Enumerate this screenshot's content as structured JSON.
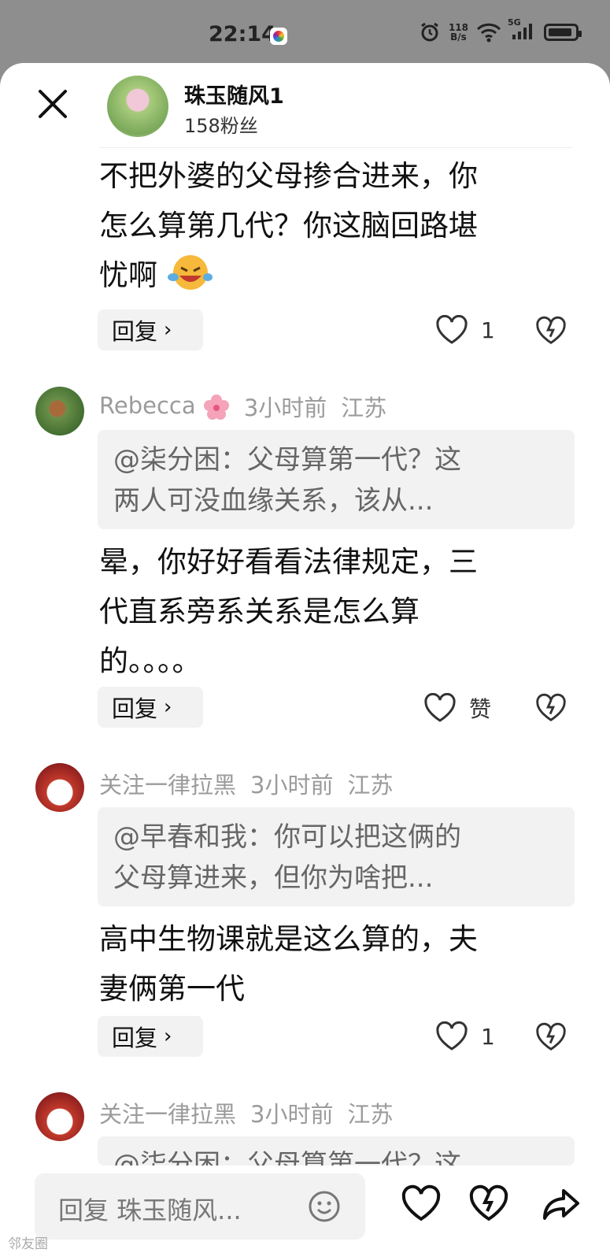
{
  "status_bar": {
    "time": "22:14",
    "net_speed_value": "118",
    "net_speed_unit": "B/s",
    "signal_label": "5G"
  },
  "header": {
    "author_name": "珠玉随风1",
    "fans": "158粉丝"
  },
  "main_comment": {
    "lines": [
      "不把外婆的父母掺合进来，你",
      "怎么算第几代？你这脑回路堪",
      "忧啊"
    ],
    "reply_label": "回复",
    "like_count": "1"
  },
  "comments": [
    {
      "user": "Rebecca",
      "time": "3小时前",
      "location": "江苏",
      "quote_lines": [
        "@柒分困：父母算第一代？这",
        "两人可没血缘关系，该从..."
      ],
      "text_lines": [
        "晕，你好好看看法律规定，三",
        "代直系旁系关系是怎么算",
        "的。。。。"
      ],
      "reply_label": "回复",
      "like_label": "赞"
    },
    {
      "user": "关注一律拉黑",
      "time": "3小时前",
      "location": "江苏",
      "quote_lines": [
        "@早春和我：你可以把这俩的",
        "父母算进来，但你为啥把..."
      ],
      "text_lines": [
        "高中生物课就是这么算的，夫",
        "妻俩第一代"
      ],
      "reply_label": "回复",
      "like_label": "1"
    },
    {
      "user": "关注一律拉黑",
      "time": "3小时前",
      "location": "江苏",
      "quote_lines": [
        "@柒分困：父母算第一代？这"
      ]
    }
  ],
  "bottom_bar": {
    "input_placeholder": "回复 珠玉随风..."
  },
  "watermark": "邻友圈"
}
